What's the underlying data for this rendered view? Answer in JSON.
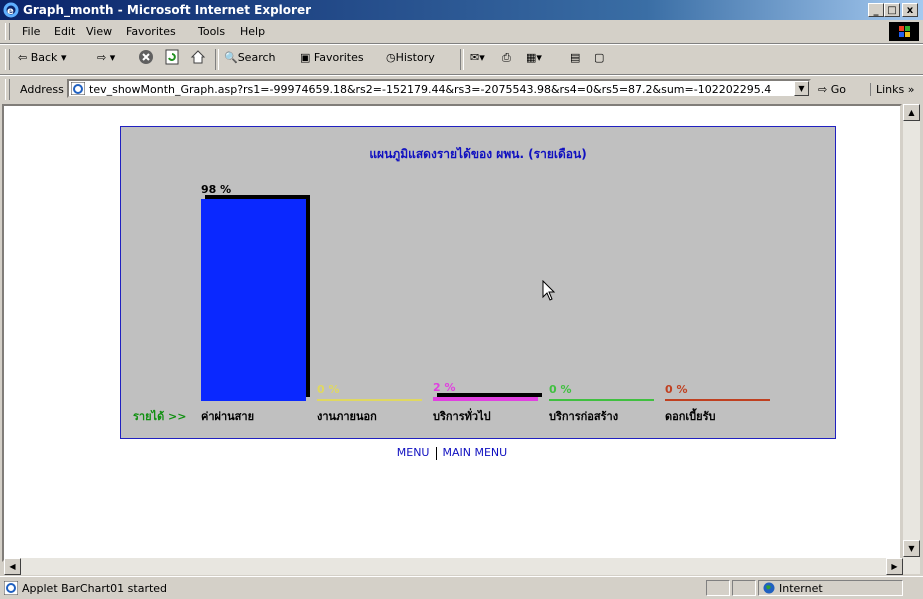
{
  "window": {
    "title": "Graph_month - Microsoft Internet Explorer",
    "min_label": "_",
    "max_label": "□",
    "close_label": "x"
  },
  "menu": [
    "File",
    "Edit",
    "View",
    "Favorites",
    "Tools",
    "Help"
  ],
  "toolbar": {
    "back_label": "Back",
    "search_label": "Search",
    "favorites_label": "Favorites",
    "history_label": "History"
  },
  "address": {
    "label": "Address",
    "url": "tev_showMonth_Graph.asp?rs1=-99974659.18&rs2=-152179.44&rs3=-2075543.98&rs4=0&rs5=87.2&sum=-102202295.4",
    "go_label": "Go",
    "links_label": "Links »"
  },
  "chart_data": {
    "type": "bar",
    "title": "แผนภูมิแสดงรายได้ของ ผพน. (รายเดือน)",
    "ylabel": "รายได้ >>",
    "categories": [
      "ค่าผ่านสาย",
      "งานภายนอก",
      "บริการทั่วไป",
      "บริการก่อสร้าง",
      "ดอกเบี้ยรับ"
    ],
    "values": [
      98,
      0,
      2,
      0,
      0
    ],
    "value_labels": [
      "98 %",
      "0 %",
      "2 %",
      "0 %",
      "0 %"
    ],
    "colors": [
      "#0a28ff",
      "#e0d860",
      "#e040e0",
      "#40c040",
      "#c04020"
    ],
    "ylim": [
      0,
      100
    ]
  },
  "page_menu": {
    "menu_label": "MENU",
    "main_menu_label": "MAIN MENU"
  },
  "status": {
    "text": "Applet BarChart01 started",
    "zone": "Internet"
  }
}
